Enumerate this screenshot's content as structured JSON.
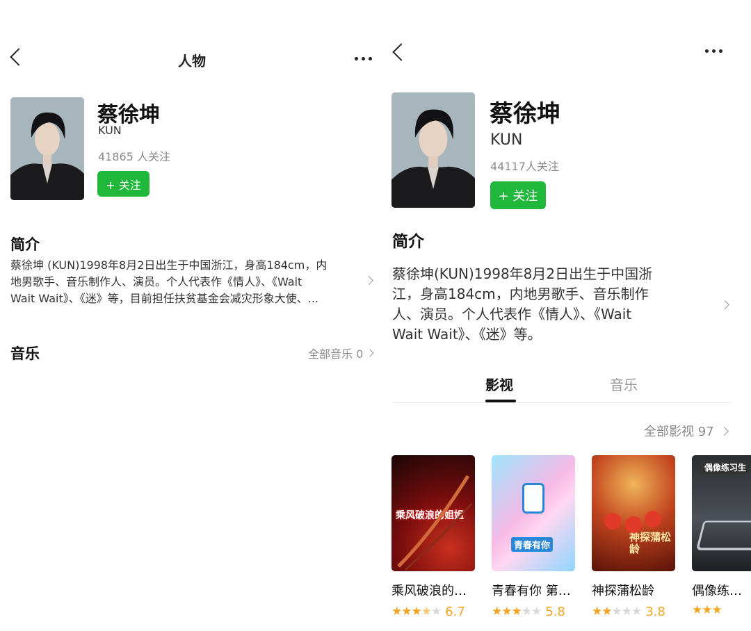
{
  "left": {
    "header": {
      "title": "人物"
    },
    "profile": {
      "name": "蔡徐坤",
      "alias": "KUN",
      "followers": "41865 人关注",
      "follow_label": "+ 关注"
    },
    "intro": {
      "title": "简介",
      "lines": [
        "蔡徐坤 (KUN)1998年8月2日出生于中国浙江，身高184cm，内",
        "地男歌手、音乐制作人、演员。个人代表作《情人》、《Wait",
        "Wait Wait》、《迷》等，目前担任扶贫基金会减灾形象大使、..."
      ]
    },
    "music": {
      "title": "音乐",
      "all_link": "全部音乐 0"
    }
  },
  "right": {
    "profile": {
      "name": "蔡徐坤",
      "alias": "KUN",
      "followers": "44117人关注",
      "follow_label": "+ 关注"
    },
    "intro": {
      "title": "简介",
      "lines": [
        "蔡徐坤(KUN)1998年8月2日出生于中国浙",
        "江，身高184cm，内地男歌手、音乐制作",
        "人、演员。个人代表作《情人》、《Wait",
        "Wait Wait》、《迷》等。"
      ]
    },
    "tabs": [
      {
        "label": "影视",
        "active": true
      },
      {
        "label": "音乐",
        "active": false
      }
    ],
    "all_films": "全部影视 97",
    "films": [
      {
        "title": "乘风破浪的…",
        "score": "6.7",
        "stars": 3.5,
        "poster_text": "乘风破浪的姐姐"
      },
      {
        "title": "青春有你 第…",
        "score": "5.8",
        "stars": 3,
        "poster_text": "青春有你"
      },
      {
        "title": "神探蒲松龄",
        "score": "3.8",
        "stars": 2,
        "poster_text": "神探蒲松龄"
      },
      {
        "title": "偶像练习生",
        "score": "",
        "stars": 3,
        "poster_text": "偶像练习生"
      }
    ]
  },
  "colors": {
    "accent_green": "#1fb83b",
    "star": "#f4a623",
    "muted": "#8a8a8a"
  },
  "icons": [
    "back-icon",
    "more-icon",
    "chevron-right-icon",
    "star-icon"
  ]
}
